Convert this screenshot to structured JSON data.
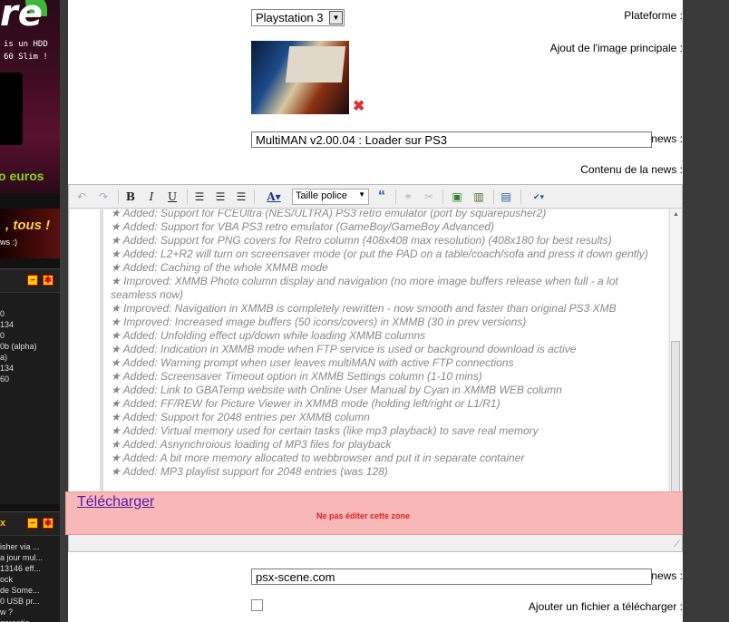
{
  "sidebar": {
    "banner_top": {
      "logo_text": "re",
      "ad_lines": [
        "is un HDD",
        "60 Slim !"
      ],
      "price": "o euros"
    },
    "banner_mid": {
      "headline": ", tous !",
      "sub": "ws :)"
    },
    "box1": {
      "lines": [
        "0",
        "134",
        "",
        "",
        "",
        "",
        "0",
        "",
        "",
        "",
        "",
        "",
        "0b (alpha)",
        "",
        "",
        "a)",
        "",
        "",
        "",
        "",
        "",
        "134",
        "60"
      ]
    },
    "box2": {
      "title": "x",
      "lines": [
        "isher via ...",
        "a jour mul...",
        "13146 eff...",
        "ock",
        "de Some...",
        "0 USB pr...",
        "w ?",
        "garantie"
      ]
    }
  },
  "form": {
    "platform_label": "Plateforme :",
    "platform_value": "Playstation 3",
    "image_label": "Ajout de l'image principale :",
    "title_label": "Titre de la news :",
    "title_value": "MultiMAN v2.00.04 : Loader sur PS3",
    "content_label": "Contenu de la news :",
    "source_label": "Source de la news :",
    "source_value": "psx-scene.com",
    "file_label": "Ajouter un fichier a télécharger :",
    "file_checked": false
  },
  "editor": {
    "font_select": "Taille police",
    "toolbar_icons": [
      "undo-icon",
      "redo-icon",
      "bold-icon",
      "italic-icon",
      "underline-icon",
      "align-left-icon",
      "align-center-icon",
      "align-right-icon",
      "font-color-icon",
      "font-size-select",
      "blockquote-icon",
      "link-icon",
      "unlink-icon",
      "insert-image-icon",
      "insert-video-icon",
      "source-view-icon",
      "spellcheck-icon"
    ],
    "lines": [
      "★ Added: Support for FCEUltra (NES/ULTRA) PS3 retro emulator (port by squarepusher2)",
      "★ Added: Support for VBA PS3 retro emulator (GameBoy/GameBoy Advanced)",
      "★ Added: Support for PNG covers for Retro column (408x408 max resolution) (408x180 for best results)",
      "★ Added: L2+R2 will turn on screensaver mode (or put the PAD on a table/coach/sofa and press it down gently)",
      "★ Added: Caching of the whole XMMB mode",
      "★ Improved: XMMB Photo column display and navigation (no more image buffers release when full - a lot seamless now)",
      "★ Improved: Navigation in XMMB is completely rewritten - now smooth and faster than original PS3 XMB",
      "★ Improved: Increased image buffers (50 icons/covers) in XMMB (30 in prev versions)",
      "★ Added: Unfolding effect up/down while loading XMMB columns",
      "★ Added: Indication in XMMB mode when FTP service is used or background download is active",
      "★ Added: Warning prompt when user leaves multiMAN with active FTP connections",
      "★ Added: Screensaver Timeout option in XMMB Settings column (1-10 mins)",
      "★ Added: Link to GBATemp website with Online User Manual by Cyan in XMMB WEB column",
      "★ Added: FF/REW for Picture Viewer in XMMB mode (holding left/right or L1/R1)",
      "★ Added: Support for 2048 entries per XMMB column",
      "★ Added: Virtual memory used for certain tasks (like mp3 playback) to save real memory",
      "★ Added: Asnynchroious loading of MP3 files for playback",
      "★ Added: A bit more memory allocated to webbrowser and put it in separate container",
      "★ Added: MP3 playlist support for 2048 entries (was 128)"
    ],
    "download_link": "Télécharger",
    "no_edit_notice": "Ne pas éditer cette zone"
  }
}
